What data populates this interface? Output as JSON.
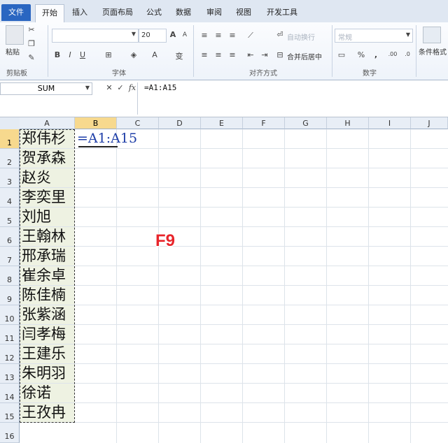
{
  "window": {
    "title_partial": ""
  },
  "tabs": [
    {
      "label": "文件"
    },
    {
      "label": "开始"
    },
    {
      "label": "插入"
    },
    {
      "label": "页面布局"
    },
    {
      "label": "公式"
    },
    {
      "label": "数据"
    },
    {
      "label": "审阅"
    },
    {
      "label": "视图"
    },
    {
      "label": "开发工具"
    }
  ],
  "ribbon": {
    "clipboard": {
      "paste": "粘贴",
      "label": "剪贴板"
    },
    "font": {
      "size": "20",
      "label": "字体",
      "grow": "A",
      "shrink": "A",
      "bold": "B",
      "italic": "I",
      "underline": "U",
      "font_color": "A",
      "wen": "变"
    },
    "alignment": {
      "wrap": "自动换行",
      "merge": "合并后居中",
      "label": "对齐方式"
    },
    "number": {
      "format": "常规",
      "percent": "%",
      "comma": ",",
      "dec_inc": ".00",
      "dec_dec": ".0",
      "label": "数字"
    },
    "styles": {
      "conditional": "条件格式"
    }
  },
  "formula_bar": {
    "name_box": "SUM",
    "cancel": "✕",
    "enter": "✓",
    "fx": "fx",
    "formula": "=A1:A15"
  },
  "columns": [
    "A",
    "B",
    "C",
    "D",
    "E",
    "F",
    "G",
    "H",
    "I",
    "J"
  ],
  "rows": [
    "1",
    "2",
    "3",
    "4",
    "5",
    "6",
    "7",
    "8",
    "9",
    "10",
    "11",
    "12",
    "13",
    "14",
    "15",
    "16"
  ],
  "cells_A": [
    "郑伟杉",
    "贺承森",
    "赵炎",
    "李奕里",
    "刘旭",
    "王翰林",
    "邢承瑞",
    "崔余卓",
    "陈佳楠",
    "张紫涵",
    "闫孝梅",
    "王建乐",
    "朱明羽",
    "徐诺",
    "王孜冉"
  ],
  "cell_B1": "=A1:A15",
  "annotation": "F9",
  "colors": {
    "file_tab": "#2a66c1",
    "selected_header": "#f7d98e",
    "cell_fill": "#eef2e2",
    "formula_text": "#1e3ea8",
    "annotation": "#e8252b"
  }
}
